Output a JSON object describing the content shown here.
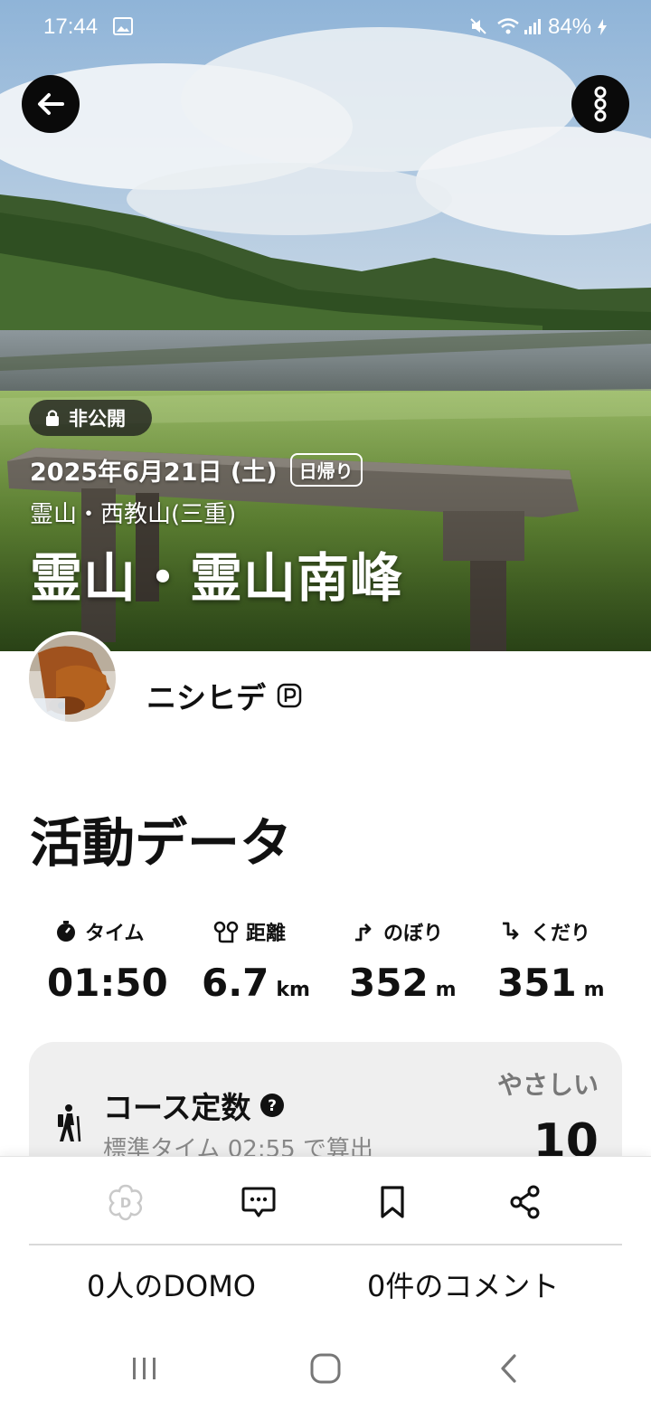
{
  "status_bar": {
    "time": "17:44",
    "battery": "84%",
    "icons": [
      "gallery-icon",
      "mute-icon",
      "wifi-icon",
      "signal-icon",
      "charging-icon"
    ]
  },
  "header": {
    "back_icon": "arrow-left-icon",
    "menu_icon": "vertical-dots-icon"
  },
  "hero": {
    "visibility_label": "非公開",
    "date": "2025年6月21日 (土)",
    "trip_type": "日帰り",
    "area": "霊山・西教山(三重)",
    "title": "霊山・霊山南峰"
  },
  "user": {
    "name": "ニシヒデ",
    "badge_icon": "premium-p-icon"
  },
  "activity": {
    "section_title": "活動データ",
    "stats": [
      {
        "label": "タイム",
        "value": "01:50",
        "unit": "",
        "icon": "stopwatch-icon"
      },
      {
        "label": "距離",
        "value": "6.7",
        "unit": "km",
        "icon": "route-pins-icon"
      },
      {
        "label": "のぼり",
        "value": "352",
        "unit": "m",
        "icon": "ascent-icon"
      },
      {
        "label": "くだり",
        "value": "351",
        "unit": "m",
        "icon": "descent-icon"
      }
    ],
    "course": {
      "title": "コース定数",
      "subtitle": "標準タイム 02:55 で算出",
      "level": "やさしい",
      "value": "10"
    }
  },
  "actions": {
    "domo_count": "0人のDOMO",
    "comment_count": "0件のコメント",
    "icons": [
      "domo-icon",
      "comment-icon",
      "bookmark-icon",
      "share-icon"
    ]
  },
  "colors": {
    "hero_overlay": "#0a0a0a",
    "card_bg": "#efefef",
    "muted_text": "#888888"
  }
}
